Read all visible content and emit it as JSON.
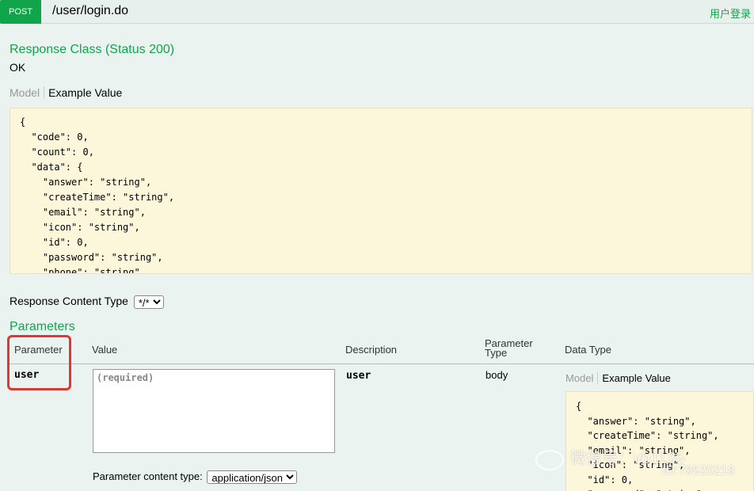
{
  "operation": {
    "method": "POST",
    "path": "/user/login.do",
    "summary": "用户登录"
  },
  "response": {
    "heading": "Response Class (Status 200)",
    "status_text": "OK",
    "tab_model": "Model",
    "tab_example": "Example Value",
    "example_json": "{\n  \"code\": 0,\n  \"count\": 0,\n  \"data\": {\n    \"answer\": \"string\",\n    \"createTime\": \"string\",\n    \"email\": \"string\",\n    \"icon\": \"string\",\n    \"id\": 0,\n    \"password\": \"string\",\n    \"phone\": \"string\","
  },
  "response_content_type": {
    "label": "Response Content Type",
    "selected": "*/*"
  },
  "parameters": {
    "heading": "Parameters",
    "headers": {
      "parameter": "Parameter",
      "value": "Value",
      "description": "Description",
      "parameter_type": "Parameter\nType",
      "data_type": "Data Type"
    },
    "rows": [
      {
        "name": "user",
        "value": "",
        "placeholder": "(required)",
        "description": "user",
        "param_type": "body",
        "tab_model": "Model",
        "tab_example": "Example Value",
        "example_json": "{\n  \"answer\": \"string\",\n  \"createTime\": \"string\",\n  \"email\": \"string\",\n  \"icon\": \"string\",\n  \"id\": 0,\n  \"password\": \"string\","
      }
    ],
    "content_type_label": "Parameter content type:",
    "content_type_selected": "application/json"
  },
  "watermark": {
    "text": "微信号：vb1135",
    "id": "ID:79520218"
  },
  "colors": {
    "accent": "#10a54a",
    "highlight_border": "#d93a37",
    "code_bg": "#fcf6db",
    "page_bg": "#ebf3f0"
  }
}
